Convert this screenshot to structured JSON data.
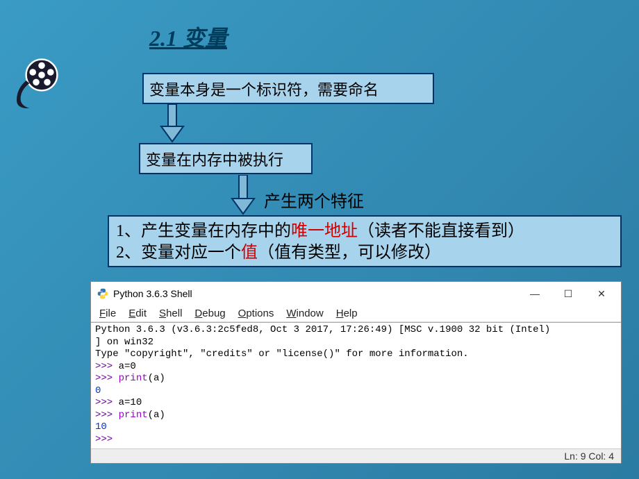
{
  "title": "2.1 变量",
  "box1": "变量本身是一个标识符，需要命名",
  "box2": "变量在内存中被执行",
  "label2": "产生两个特征",
  "box3": {
    "line1_pre": "1、产生变量在内存中的",
    "line1_red": "唯一地址",
    "line1_post": "（读者不能直接看到）",
    "line2_pre": "2、变量对应一个",
    "line2_red": "值",
    "line2_post": "（值有类型，可以修改）"
  },
  "shell": {
    "title": "Python 3.6.3 Shell",
    "menu": [
      "File",
      "Edit",
      "Shell",
      "Debug",
      "Options",
      "Window",
      "Help"
    ],
    "banner1": "Python 3.6.3 (v3.6.3:2c5fed8, Oct  3 2017, 17:26:49) [MSC v.1900 32 bit (Intel)",
    "banner1b": "] on win32",
    "banner2": "Type \"copyright\", \"credits\" or \"license()\" for more information.",
    "lines": [
      {
        "prompt": ">>> ",
        "code": "a=0"
      },
      {
        "prompt": ">>> ",
        "kw": "print",
        "rest": "(a)"
      },
      {
        "out": "0"
      },
      {
        "prompt": ">>> ",
        "code": "a=10"
      },
      {
        "prompt": ">>> ",
        "kw": "print",
        "rest": "(a)"
      },
      {
        "out": "10"
      },
      {
        "prompt": ">>> "
      }
    ],
    "status": "Ln: 9  Col: 4"
  }
}
